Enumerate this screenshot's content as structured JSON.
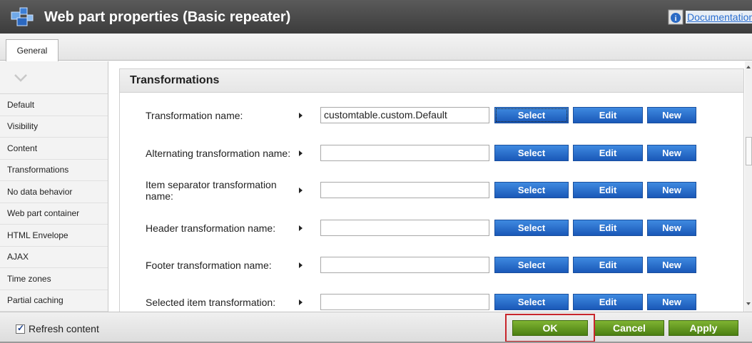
{
  "window": {
    "title": "Web part properties (Basic repeater)",
    "documentation_label": "Documentation"
  },
  "tabs": [
    {
      "label": "General",
      "selected": true
    }
  ],
  "sidebar": {
    "items": [
      {
        "label": "Default"
      },
      {
        "label": "Visibility"
      },
      {
        "label": "Content"
      },
      {
        "label": "Transformations"
      },
      {
        "label": "No data behavior"
      },
      {
        "label": "Web part container"
      },
      {
        "label": "HTML Envelope"
      },
      {
        "label": "AJAX"
      },
      {
        "label": "Time zones"
      },
      {
        "label": "Partial caching"
      }
    ]
  },
  "section": {
    "title": "Transformations"
  },
  "buttons": {
    "select": "Select",
    "edit": "Edit",
    "new": "New"
  },
  "rows": [
    {
      "label": "Transformation name:",
      "value": "customtable.custom.Default"
    },
    {
      "label": "Alternating transformation name:",
      "value": ""
    },
    {
      "label": "Item separator transformation name:",
      "value": ""
    },
    {
      "label": "Header transformation name:",
      "value": ""
    },
    {
      "label": "Footer transformation name:",
      "value": ""
    },
    {
      "label": "Selected item transformation:",
      "value": ""
    }
  ],
  "footer": {
    "refresh_label": "Refresh content",
    "refresh_checked": true,
    "ok": "OK",
    "cancel": "Cancel",
    "apply": "Apply"
  },
  "colors": {
    "titlebar": "#4a4a4a",
    "blue_button": "#1f63c3",
    "green_button": "#5f9320",
    "highlight": "#c8262c"
  }
}
